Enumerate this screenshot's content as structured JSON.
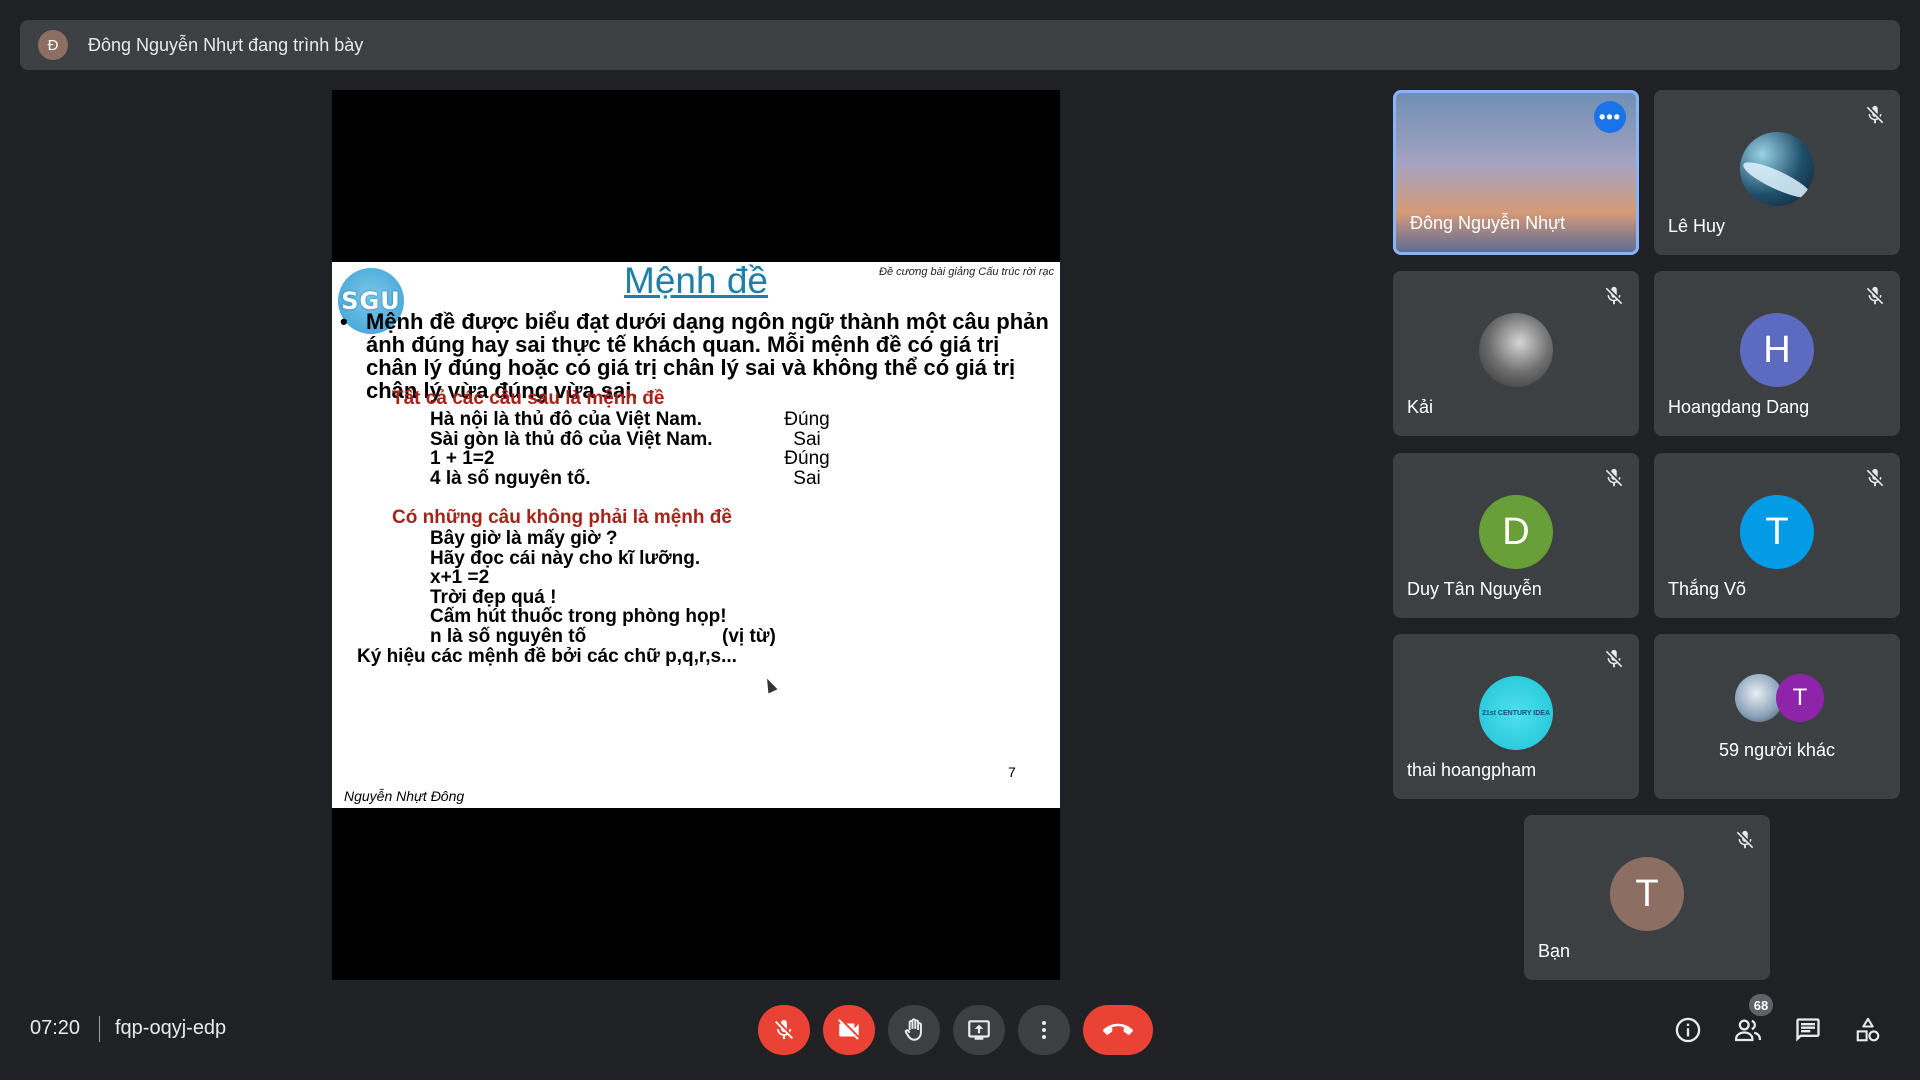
{
  "banner": {
    "avatar_letter": "Đ",
    "text": "Đông Nguyễn Nhựt đang trình bày"
  },
  "slide": {
    "logo": "SGU",
    "title": "Mệnh đề",
    "header_note": "Đề cương bài giảng Cấu trúc rời rạc",
    "bullet": "•",
    "definition": "Mệnh đề được biểu đạt dưới dạng ngôn ngữ thành một câu phản ánh đúng hay sai thực tế khách quan. Mỗi mệnh đề có giá trị chân lý đúng hoặc có giá trị chân lý sai và không thể có giá trị chân lý vừa đúng vừa sai.",
    "section1_title": "Tất cả các câu sau là mệnh đề",
    "section1_rows": [
      {
        "text": "Hà nội là thủ đô của Việt Nam.",
        "value": "Đúng"
      },
      {
        "text": "Sài gòn là thủ đô của Việt Nam.",
        "value": "Sai"
      },
      {
        "text": "1 + 1=2",
        "value": "Đúng"
      },
      {
        "text": "4 là số nguyên tố.",
        "value": "Sai"
      }
    ],
    "section2_title": "Có những câu không phải là mệnh đề",
    "section2_rows": [
      "Bây giờ là mấy giờ ?",
      "Hãy đọc cái này cho kĩ lưỡng.",
      "x+1 =2",
      "Trời đẹp quá !",
      "Cấm hút thuốc trong phòng họp!",
      "n là số nguyên tố"
    ],
    "predicate_note": "(vị từ)",
    "notation": "Ký hiệu các mệnh đề bởi các chữ p,q,r,s...",
    "page_number": "7",
    "author": "Nguyễn Nhựt Đông"
  },
  "participants": [
    {
      "name": "Đông Nguyễn Nhựt"
    },
    {
      "name": "Lê Huy"
    },
    {
      "name": "Kải"
    },
    {
      "name": "Hoangdang Dang",
      "letter": "H",
      "color": "#5c6bc0"
    },
    {
      "name": "Duy Tân Nguyễn",
      "letter": "D",
      "color": "#689f38"
    },
    {
      "name": "Thắng Võ",
      "letter": "T",
      "color": "#039be5"
    },
    {
      "name": "thai hoangpham",
      "avatar_text": "21st CENTURY IDEA"
    },
    {
      "name": "59 người khác",
      "letter": "T",
      "color": "#8e24aa"
    },
    {
      "name": "Bạn",
      "letter": "T",
      "color": "#8d6e63"
    }
  ],
  "bottom": {
    "time": "07:20",
    "meeting_code": "fqp-oqyj-edp",
    "participant_count": "68"
  },
  "colors": {
    "red": "#ea4335",
    "accent": "#8ab4f8",
    "tile": "#3c4043",
    "background": "#202124"
  }
}
